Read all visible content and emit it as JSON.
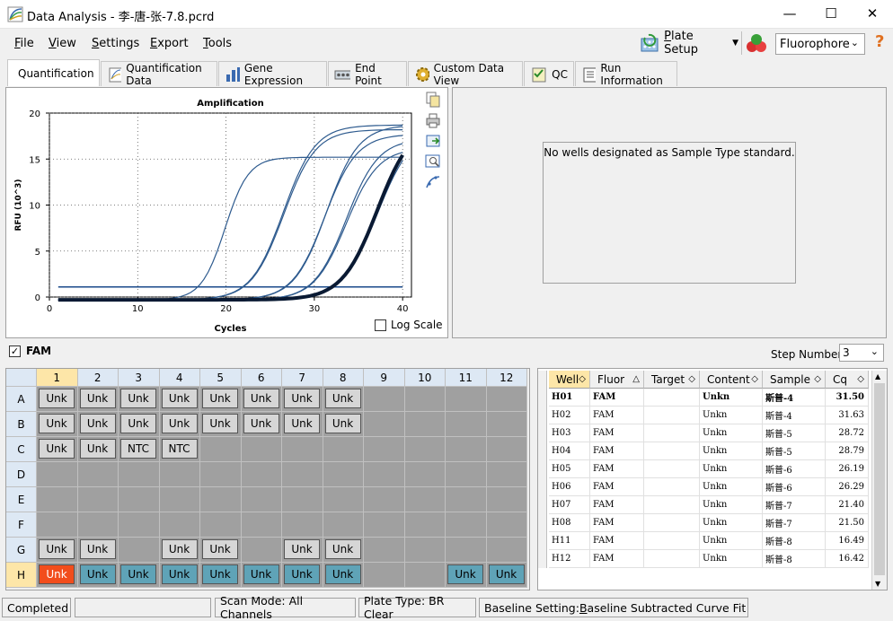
{
  "window": {
    "title": "Data Analysis - 李-唐-张-7.8.pcrd"
  },
  "menu": [
    {
      "label": "File",
      "key": "F",
      "rest": "ile"
    },
    {
      "label": "View",
      "key": "V",
      "rest": "iew"
    },
    {
      "label": "Settings",
      "key": "S",
      "rest": "ettings"
    },
    {
      "label": "Export",
      "key": "E",
      "rest": "xport"
    },
    {
      "label": "Tools",
      "key": "T",
      "rest": "ools"
    }
  ],
  "toolbar": {
    "plate_setup_key": "P",
    "plate_setup_rest": "late Setup",
    "fluorophore": "Fluorophore",
    "help": "?"
  },
  "tabs": [
    "Quantification",
    "Quantification Data",
    "Gene Expression",
    "End Point",
    "Custom Data View",
    "QC",
    "Run Information"
  ],
  "chart": {
    "log_scale_label": "Log Scale",
    "log_scale_checked": false
  },
  "chart_data": {
    "type": "line",
    "title": "Amplification",
    "xlabel": "Cycles",
    "ylabel": "RFU (10^3)",
    "xlim": [
      0,
      41
    ],
    "ylim": [
      0,
      20
    ],
    "xticks": [
      0,
      10,
      20,
      30,
      40
    ],
    "yticks": [
      0,
      5,
      10,
      15,
      20
    ],
    "threshold": 1.1,
    "series": [
      {
        "cq": 16.45,
        "plateau": 15.5,
        "k": 0.75
      },
      {
        "cq": 21.4,
        "plateau": 19.0,
        "k": 0.55
      },
      {
        "cq": 21.5,
        "plateau": 18.5,
        "k": 0.55
      },
      {
        "cq": 26.2,
        "plateau": 18.0,
        "k": 0.55
      },
      {
        "cq": 26.3,
        "plateau": 19.0,
        "k": 0.55
      },
      {
        "cq": 28.7,
        "plateau": 17.5,
        "k": 0.55
      },
      {
        "cq": 28.8,
        "plateau": 16.5,
        "k": 0.55
      },
      {
        "cq": 31.5,
        "plateau": 19.5,
        "k": 0.5,
        "highlight": true
      },
      {
        "cq": 31.6,
        "plateau": 18.8,
        "k": 0.5
      }
    ]
  },
  "standard_panel": {
    "message": "No wells designated as Sample Type standard."
  },
  "fam": {
    "label": "FAM",
    "checked": true,
    "step_label": "Step Number:",
    "step_value": "3"
  },
  "plate": {
    "columns": [
      "1",
      "2",
      "3",
      "4",
      "5",
      "6",
      "7",
      "8",
      "9",
      "10",
      "11",
      "12"
    ],
    "rows": [
      {
        "label": "A",
        "wells": [
          "Unk",
          "Unk",
          "Unk",
          "Unk",
          "Unk",
          "Unk",
          "Unk",
          "Unk",
          "",
          "",
          "",
          ""
        ]
      },
      {
        "label": "B",
        "wells": [
          "Unk",
          "Unk",
          "Unk",
          "Unk",
          "Unk",
          "Unk",
          "Unk",
          "Unk",
          "",
          "",
          "",
          ""
        ]
      },
      {
        "label": "C",
        "wells": [
          "Unk",
          "Unk",
          "NTC",
          "NTC",
          "",
          "",
          "",
          "",
          "",
          "",
          "",
          ""
        ]
      },
      {
        "label": "D",
        "wells": [
          "",
          "",
          "",
          "",
          "",
          "",
          "",
          "",
          "",
          "",
          "",
          ""
        ]
      },
      {
        "label": "E",
        "wells": [
          "",
          "",
          "",
          "",
          "",
          "",
          "",
          "",
          "",
          "",
          "",
          ""
        ]
      },
      {
        "label": "F",
        "wells": [
          "",
          "",
          "",
          "",
          "",
          "",
          "",
          "",
          "",
          "",
          "",
          ""
        ]
      },
      {
        "label": "G",
        "wells": [
          "Unk",
          "Unk",
          "",
          "Unk",
          "Unk",
          "",
          "Unk",
          "Unk",
          "",
          "",
          "",
          ""
        ]
      },
      {
        "label": "H",
        "wells": [
          "Unk",
          "Unk",
          "Unk",
          "Unk",
          "Unk",
          "Unk",
          "Unk",
          "Unk",
          "",
          "",
          "Unk",
          "Unk"
        ]
      }
    ]
  },
  "table": {
    "headers": [
      "Well",
      "Fluor",
      "Target",
      "Content",
      "Sample",
      "Cq"
    ],
    "rows": [
      [
        "H01",
        "FAM",
        "",
        "Unkn",
        "斯普-4",
        "31.50"
      ],
      [
        "H02",
        "FAM",
        "",
        "Unkn",
        "斯普-4",
        "31.63"
      ],
      [
        "H03",
        "FAM",
        "",
        "Unkn",
        "斯普-5",
        "28.72"
      ],
      [
        "H04",
        "FAM",
        "",
        "Unkn",
        "斯普-5",
        "28.79"
      ],
      [
        "H05",
        "FAM",
        "",
        "Unkn",
        "斯普-6",
        "26.19"
      ],
      [
        "H06",
        "FAM",
        "",
        "Unkn",
        "斯普-6",
        "26.29"
      ],
      [
        "H07",
        "FAM",
        "",
        "Unkn",
        "斯普-7",
        "21.40"
      ],
      [
        "H08",
        "FAM",
        "",
        "Unkn",
        "斯普-7",
        "21.50"
      ],
      [
        "H11",
        "FAM",
        "",
        "Unkn",
        "斯普-8",
        "16.49"
      ],
      [
        "H12",
        "FAM",
        "",
        "Unkn",
        "斯普-8",
        "16.42"
      ]
    ]
  },
  "status": {
    "completed": "Completed",
    "scan_mode": "Scan Mode: All Channels",
    "plate_type": "Plate Type: BR Clear",
    "baseline_prefix": "Baseline Setting: ",
    "baseline_key": "B",
    "baseline_rest": "aseline Subtracted Curve Fit"
  }
}
